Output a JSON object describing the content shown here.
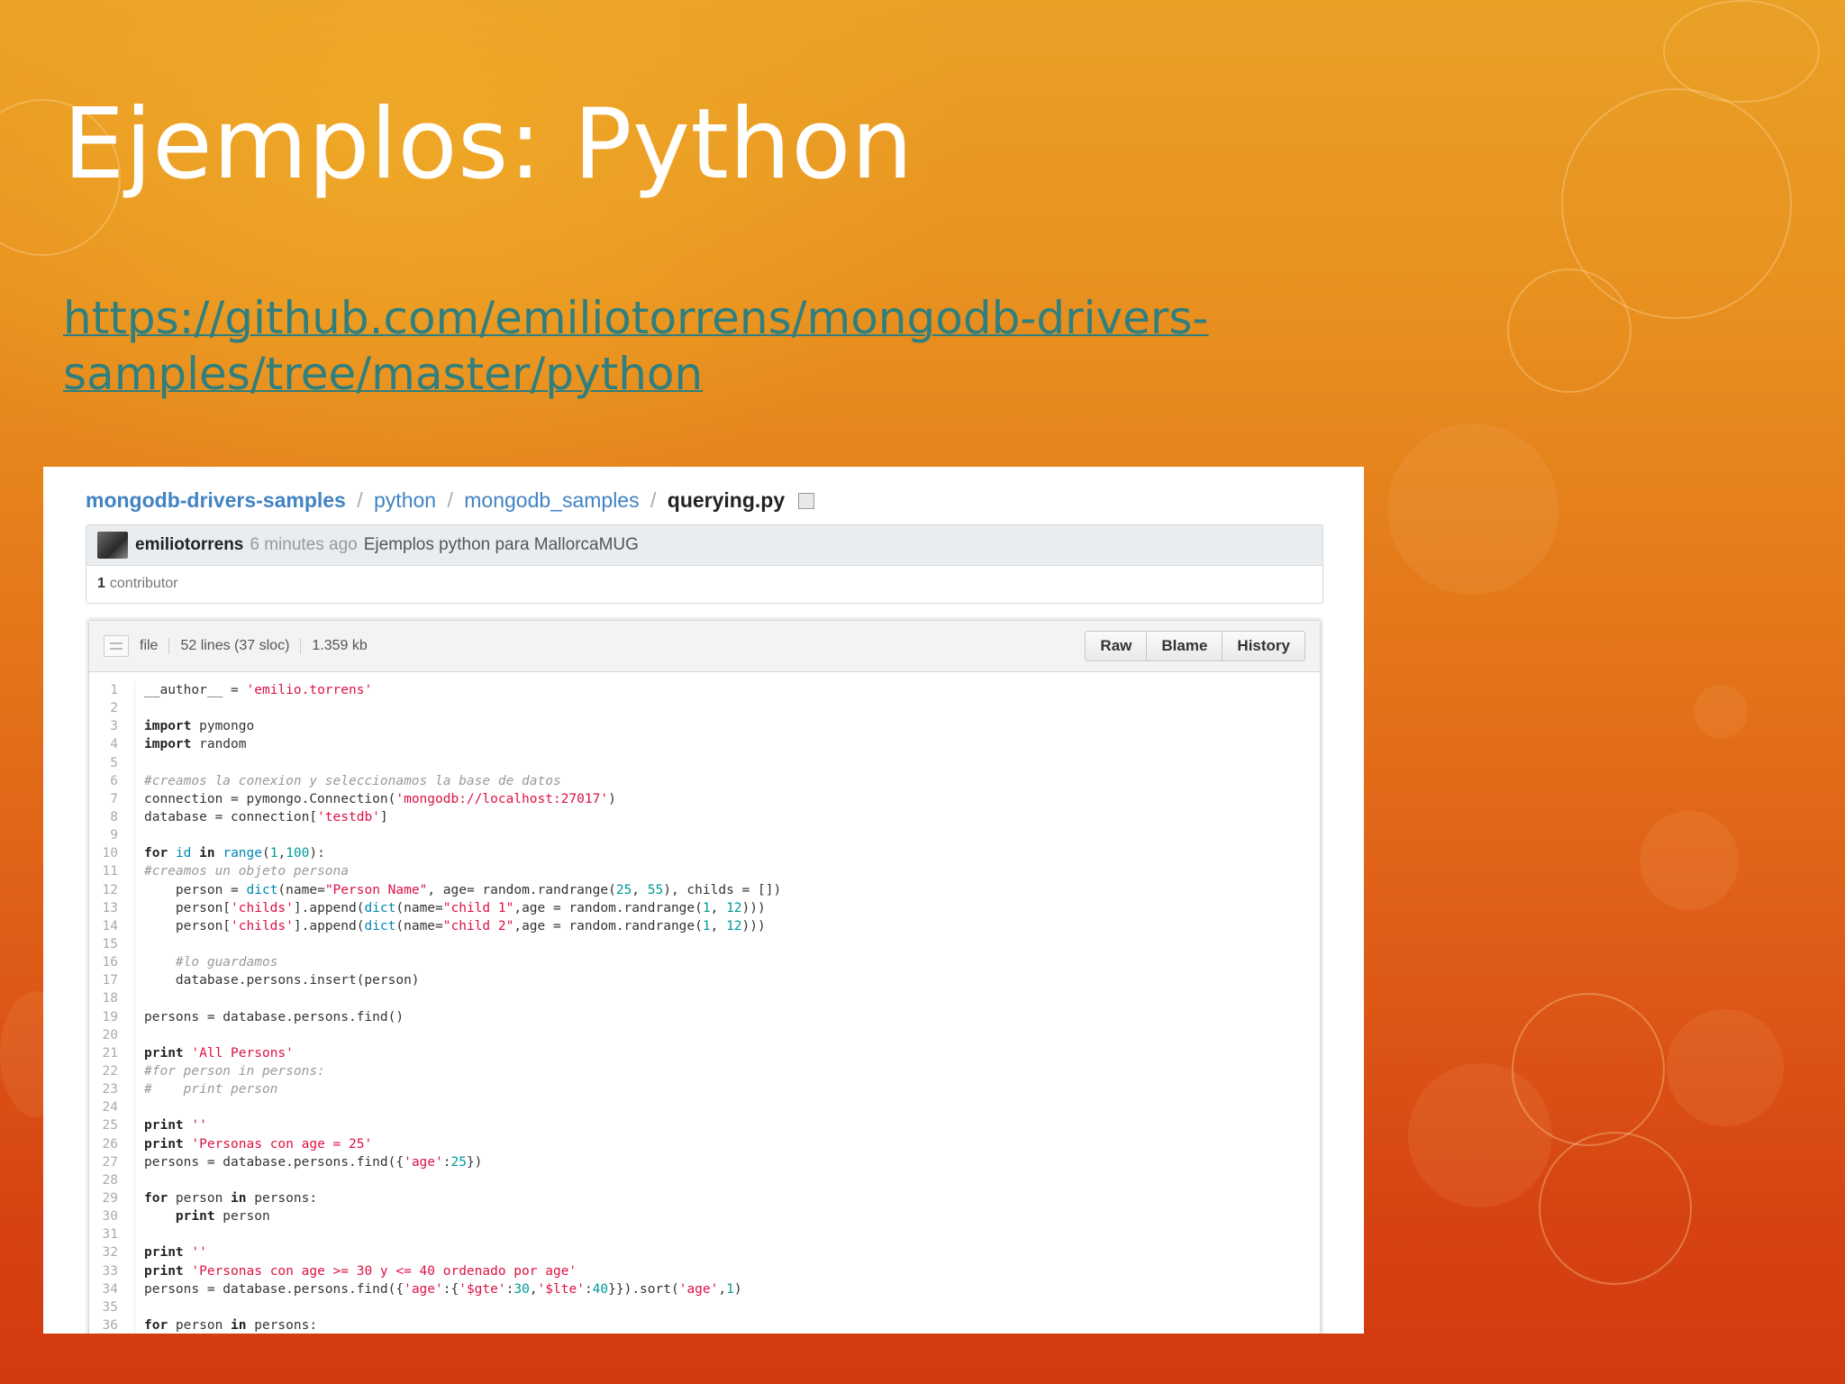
{
  "slide": {
    "title": "Ejemplos: Python",
    "link_line1": "https://github.com/emiliotorrens/mongodb-drivers-",
    "link_line2": "samples/tree/master/python"
  },
  "breadcrumb": {
    "repo": "mongodb-drivers-samples",
    "path1": "python",
    "path2": "mongodb_samples",
    "file": "querying.py",
    "separator": "/"
  },
  "commit": {
    "author": "emiliotorrens",
    "time": "6 minutes ago",
    "message": "Ejemplos python para MallorcaMUG",
    "contributors_count": "1",
    "contributors_label": "contributor"
  },
  "file_header": {
    "type": "file",
    "lines": "52 lines (37 sloc)",
    "size": "1.359 kb",
    "buttons": [
      "Raw",
      "Blame",
      "History"
    ]
  },
  "colors": {
    "link": "#2f7f7e",
    "github_link": "#4183c4",
    "string": "#dd1144",
    "number": "#009999"
  },
  "code": [
    [
      {
        "t": "__author__ = "
      },
      {
        "t": "'emilio.torrens'",
        "c": "s"
      }
    ],
    [],
    [
      {
        "t": "import",
        "c": "k"
      },
      {
        "t": " pymongo"
      }
    ],
    [
      {
        "t": "import",
        "c": "k"
      },
      {
        "t": " random"
      }
    ],
    [],
    [
      {
        "t": "#creamos la conexion y seleccionamos la base de datos",
        "c": "c"
      }
    ],
    [
      {
        "t": "connection = pymongo.Connection("
      },
      {
        "t": "'mongodb://localhost:27017'",
        "c": "s"
      },
      {
        "t": ")"
      }
    ],
    [
      {
        "t": "database = connection["
      },
      {
        "t": "'testdb'",
        "c": "s"
      },
      {
        "t": "]"
      }
    ],
    [],
    [
      {
        "t": "for",
        "c": "k"
      },
      {
        "t": " "
      },
      {
        "t": "id",
        "c": "b"
      },
      {
        "t": " "
      },
      {
        "t": "in",
        "c": "k"
      },
      {
        "t": " "
      },
      {
        "t": "range",
        "c": "b"
      },
      {
        "t": "("
      },
      {
        "t": "1",
        "c": "n"
      },
      {
        "t": ","
      },
      {
        "t": "100",
        "c": "n"
      },
      {
        "t": "):"
      }
    ],
    [
      {
        "t": "#creamos un objeto persona",
        "c": "c"
      }
    ],
    [
      {
        "t": "    person = "
      },
      {
        "t": "dict",
        "c": "b"
      },
      {
        "t": "(name="
      },
      {
        "t": "\"Person Name\"",
        "c": "s"
      },
      {
        "t": ", age= random.randrange("
      },
      {
        "t": "25",
        "c": "n"
      },
      {
        "t": ", "
      },
      {
        "t": "55",
        "c": "n"
      },
      {
        "t": "), childs = [])"
      }
    ],
    [
      {
        "t": "    person["
      },
      {
        "t": "'childs'",
        "c": "s"
      },
      {
        "t": "].append("
      },
      {
        "t": "dict",
        "c": "b"
      },
      {
        "t": "(name="
      },
      {
        "t": "\"child 1\"",
        "c": "s"
      },
      {
        "t": ",age = random.randrange("
      },
      {
        "t": "1",
        "c": "n"
      },
      {
        "t": ", "
      },
      {
        "t": "12",
        "c": "n"
      },
      {
        "t": ")))"
      }
    ],
    [
      {
        "t": "    person["
      },
      {
        "t": "'childs'",
        "c": "s"
      },
      {
        "t": "].append("
      },
      {
        "t": "dict",
        "c": "b"
      },
      {
        "t": "(name="
      },
      {
        "t": "\"child 2\"",
        "c": "s"
      },
      {
        "t": ",age = random.randrange("
      },
      {
        "t": "1",
        "c": "n"
      },
      {
        "t": ", "
      },
      {
        "t": "12",
        "c": "n"
      },
      {
        "t": ")))"
      }
    ],
    [],
    [
      {
        "t": "    "
      },
      {
        "t": "#lo guardamos",
        "c": "c"
      }
    ],
    [
      {
        "t": "    database.persons.insert(person)"
      }
    ],
    [],
    [
      {
        "t": "persons = database.persons.find()"
      }
    ],
    [],
    [
      {
        "t": "print",
        "c": "k"
      },
      {
        "t": " "
      },
      {
        "t": "'All Persons'",
        "c": "s"
      }
    ],
    [
      {
        "t": "#for person in persons:",
        "c": "c"
      }
    ],
    [
      {
        "t": "#    print person",
        "c": "c"
      }
    ],
    [],
    [
      {
        "t": "print",
        "c": "k"
      },
      {
        "t": " "
      },
      {
        "t": "''",
        "c": "s"
      }
    ],
    [
      {
        "t": "print",
        "c": "k"
      },
      {
        "t": " "
      },
      {
        "t": "'Personas con age = 25'",
        "c": "s"
      }
    ],
    [
      {
        "t": "persons = database.persons.find({"
      },
      {
        "t": "'age'",
        "c": "s"
      },
      {
        "t": ":"
      },
      {
        "t": "25",
        "c": "n"
      },
      {
        "t": "})"
      }
    ],
    [],
    [
      {
        "t": "for",
        "c": "k"
      },
      {
        "t": " person "
      },
      {
        "t": "in",
        "c": "k"
      },
      {
        "t": " persons:"
      }
    ],
    [
      {
        "t": "    "
      },
      {
        "t": "print",
        "c": "k"
      },
      {
        "t": " person"
      }
    ],
    [],
    [
      {
        "t": "print",
        "c": "k"
      },
      {
        "t": " "
      },
      {
        "t": "''",
        "c": "s"
      }
    ],
    [
      {
        "t": "print",
        "c": "k"
      },
      {
        "t": " "
      },
      {
        "t": "'Personas con age >= 30 y <= 40 ordenado por age'",
        "c": "s"
      }
    ],
    [
      {
        "t": "persons = database.persons.find({"
      },
      {
        "t": "'age'",
        "c": "s"
      },
      {
        "t": ":{"
      },
      {
        "t": "'$gte'",
        "c": "s"
      },
      {
        "t": ":"
      },
      {
        "t": "30",
        "c": "n"
      },
      {
        "t": ","
      },
      {
        "t": "'$lte'",
        "c": "s"
      },
      {
        "t": ":"
      },
      {
        "t": "40",
        "c": "n"
      },
      {
        "t": "}}).sort("
      },
      {
        "t": "'age'",
        "c": "s"
      },
      {
        "t": ","
      },
      {
        "t": "1",
        "c": "n"
      },
      {
        "t": ")"
      }
    ],
    [],
    [
      {
        "t": "for",
        "c": "k"
      },
      {
        "t": " person "
      },
      {
        "t": "in",
        "c": "k"
      },
      {
        "t": " persons:"
      }
    ]
  ]
}
